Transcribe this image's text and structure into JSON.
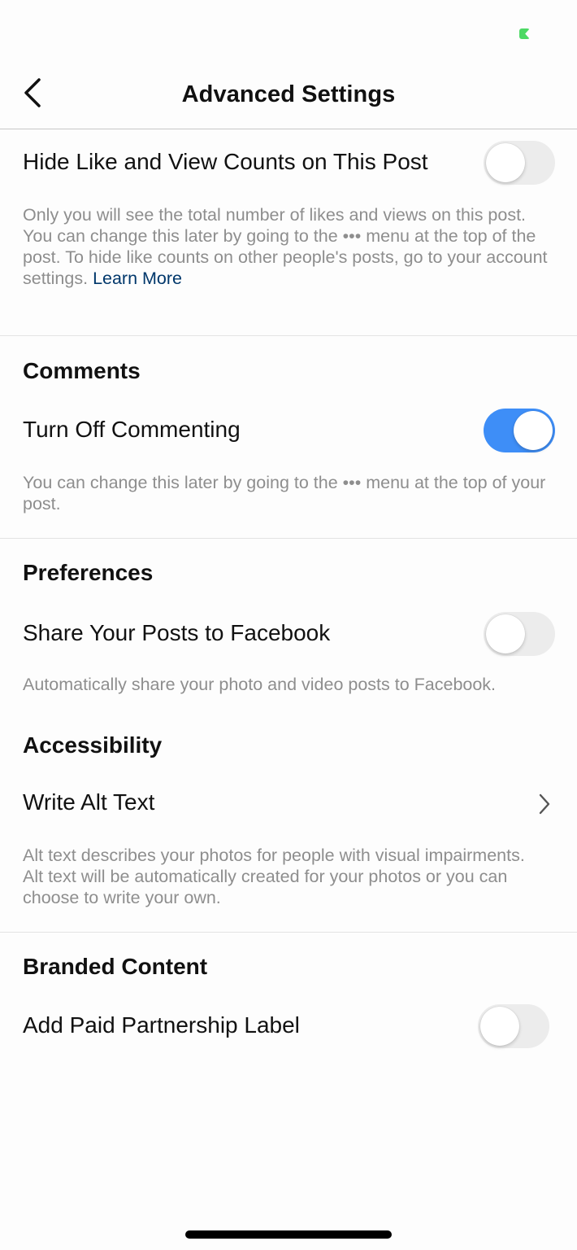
{
  "nav": {
    "title": "Advanced Settings"
  },
  "hide_counts": {
    "label": "Hide Like and View Counts on This Post",
    "toggle": "off",
    "description": "Only you will see the total number of likes and views on this post. You can change this later by going to the ••• menu at the top of the post. To hide like counts on other people's posts, go to your account settings.",
    "link": "Learn More"
  },
  "comments": {
    "section_title": "Comments",
    "label": "Turn Off Commenting",
    "toggle": "on",
    "description": "You can change this later by going to the ••• menu at the top of your post."
  },
  "preferences": {
    "section_title": "Preferences",
    "label": "Share Your Posts to Facebook",
    "toggle": "off",
    "description": "Automatically share your photo and video posts to Facebook."
  },
  "accessibility": {
    "section_title": "Accessibility",
    "label": "Write Alt Text",
    "description": "Alt text describes your photos for people with visual impairments. Alt text will be automatically created for your photos or you can choose to write your own."
  },
  "branded": {
    "section_title": "Branded Content",
    "label": "Add Paid Partnership Label",
    "toggle": "off"
  },
  "colors": {
    "toggle_on": "#3e8ef7",
    "toggle_off": "#ececec",
    "link": "#00376b",
    "description_text": "#8e8e8e"
  }
}
